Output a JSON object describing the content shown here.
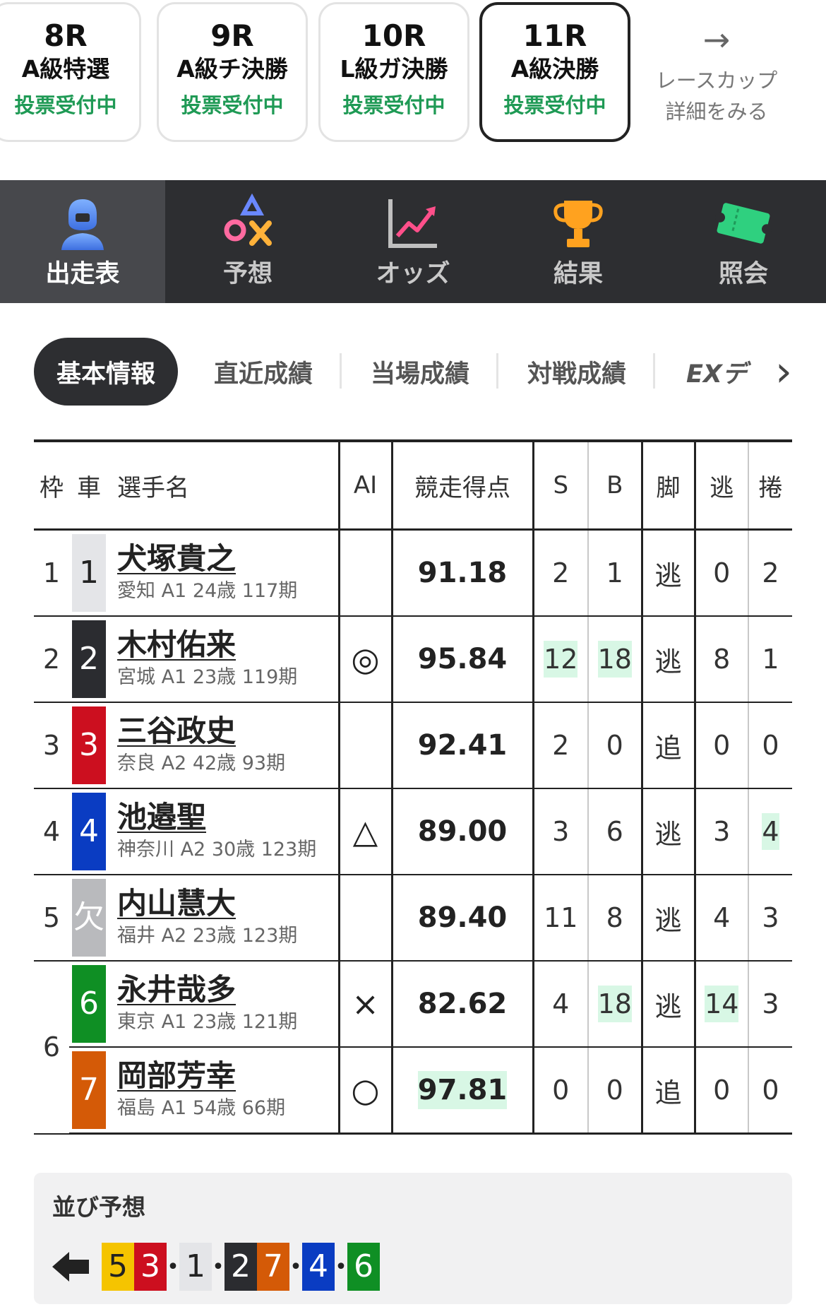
{
  "races": [
    {
      "num": "8R",
      "name": "A級特選",
      "status": "投票受付中"
    },
    {
      "num": "9R",
      "name": "A級チ決勝",
      "status": "投票受付中"
    },
    {
      "num": "10R",
      "name": "L級ガ決勝",
      "status": "投票受付中"
    },
    {
      "num": "11R",
      "name": "A級決勝",
      "status": "投票受付中"
    }
  ],
  "cup_link": {
    "arrow": "→",
    "line1": "レースカップ",
    "line2": "詳細をみる"
  },
  "nav": [
    {
      "label": "出走表",
      "icon": "racer-icon"
    },
    {
      "label": "予想",
      "icon": "prediction-shapes-icon"
    },
    {
      "label": "オッズ",
      "icon": "odds-chart-icon"
    },
    {
      "label": "結果",
      "icon": "trophy-icon"
    },
    {
      "label": "照会",
      "icon": "ticket-icon"
    }
  ],
  "subtabs": [
    "基本情報",
    "直近成績",
    "当場成績",
    "対戦成績",
    "EXデ"
  ],
  "subtab_more": "›",
  "table": {
    "headers": {
      "waku": "枠",
      "car": "車",
      "name": "選手名",
      "ai": "AI",
      "score": "競走得点",
      "s": "S",
      "b": "B",
      "leg": "脚",
      "nige": "逃",
      "makuri": "捲"
    },
    "rows": [
      {
        "waku": "1",
        "car": "1",
        "car_color": "#e4e5e8",
        "car_text_color": "#222222",
        "name": "犬塚貴之",
        "info": "愛知 A1 24歳 117期",
        "ai": "",
        "score": "91.18",
        "s": "2",
        "b": "1",
        "leg": "逃",
        "nige": "0",
        "makuri": "2"
      },
      {
        "waku": "2",
        "car": "2",
        "car_color": "#2b2c30",
        "car_text_color": "#ffffff",
        "name": "木村佑来",
        "info": "宮城 A1 23歳 119期",
        "ai": "◎",
        "score": "95.84",
        "s": "12",
        "b": "18",
        "leg": "逃",
        "nige": "8",
        "makuri": "1"
      },
      {
        "waku": "3",
        "car": "3",
        "car_color": "#cc0f1f",
        "car_text_color": "#ffffff",
        "name": "三谷政史",
        "info": "奈良 A2 42歳 93期",
        "ai": "",
        "score": "92.41",
        "s": "2",
        "b": "0",
        "leg": "追",
        "nige": "0",
        "makuri": "0"
      },
      {
        "waku": "4",
        "car": "4",
        "car_color": "#0a3cc2",
        "car_text_color": "#ffffff",
        "name": "池邉聖",
        "info": "神奈川 A2 30歳 123期",
        "ai": "△",
        "score": "89.00",
        "s": "3",
        "b": "6",
        "leg": "逃",
        "nige": "3",
        "makuri": "4"
      },
      {
        "waku": "5",
        "car": "欠",
        "car_color": "#b9babd",
        "car_text_color": "#ffffff",
        "name": "内山慧大",
        "info": "福井 A2 23歳 123期",
        "ai": "",
        "score": "89.40",
        "s": "11",
        "b": "8",
        "leg": "逃",
        "nige": "4",
        "makuri": "3"
      },
      {
        "waku": "6",
        "car": "6",
        "car_color": "#0f8f24",
        "car_text_color": "#ffffff",
        "name": "永井哉多",
        "info": "東京 A1 23歳 121期",
        "ai": "×",
        "score": "82.62",
        "s": "4",
        "b": "18",
        "leg": "逃",
        "nige": "14",
        "makuri": "3"
      },
      {
        "waku": "",
        "car": "7",
        "car_color": "#d45a07",
        "car_text_color": "#ffffff",
        "name": "岡部芳幸",
        "info": "福島 A1 54歳 66期",
        "ai": "○",
        "score": "97.81",
        "s": "0",
        "b": "0",
        "leg": "追",
        "nige": "0",
        "makuri": "0"
      }
    ]
  },
  "narabi": {
    "title": "並び予想",
    "arrow": "🡄",
    "groups": [
      [
        {
          "n": "5",
          "color": "#f5c400",
          "text": "#222222"
        },
        {
          "n": "3",
          "color": "#cc0f1f",
          "text": "#ffffff"
        }
      ],
      [
        {
          "n": "1",
          "color": "#e4e5e8",
          "text": "#222222"
        }
      ],
      [
        {
          "n": "2",
          "color": "#2b2c30",
          "text": "#ffffff"
        },
        {
          "n": "7",
          "color": "#d45a07",
          "text": "#ffffff"
        }
      ],
      [
        {
          "n": "4",
          "color": "#0a3cc2",
          "text": "#ffffff"
        }
      ],
      [
        {
          "n": "6",
          "color": "#0f8f24",
          "text": "#ffffff"
        }
      ]
    ],
    "separator": "•"
  }
}
